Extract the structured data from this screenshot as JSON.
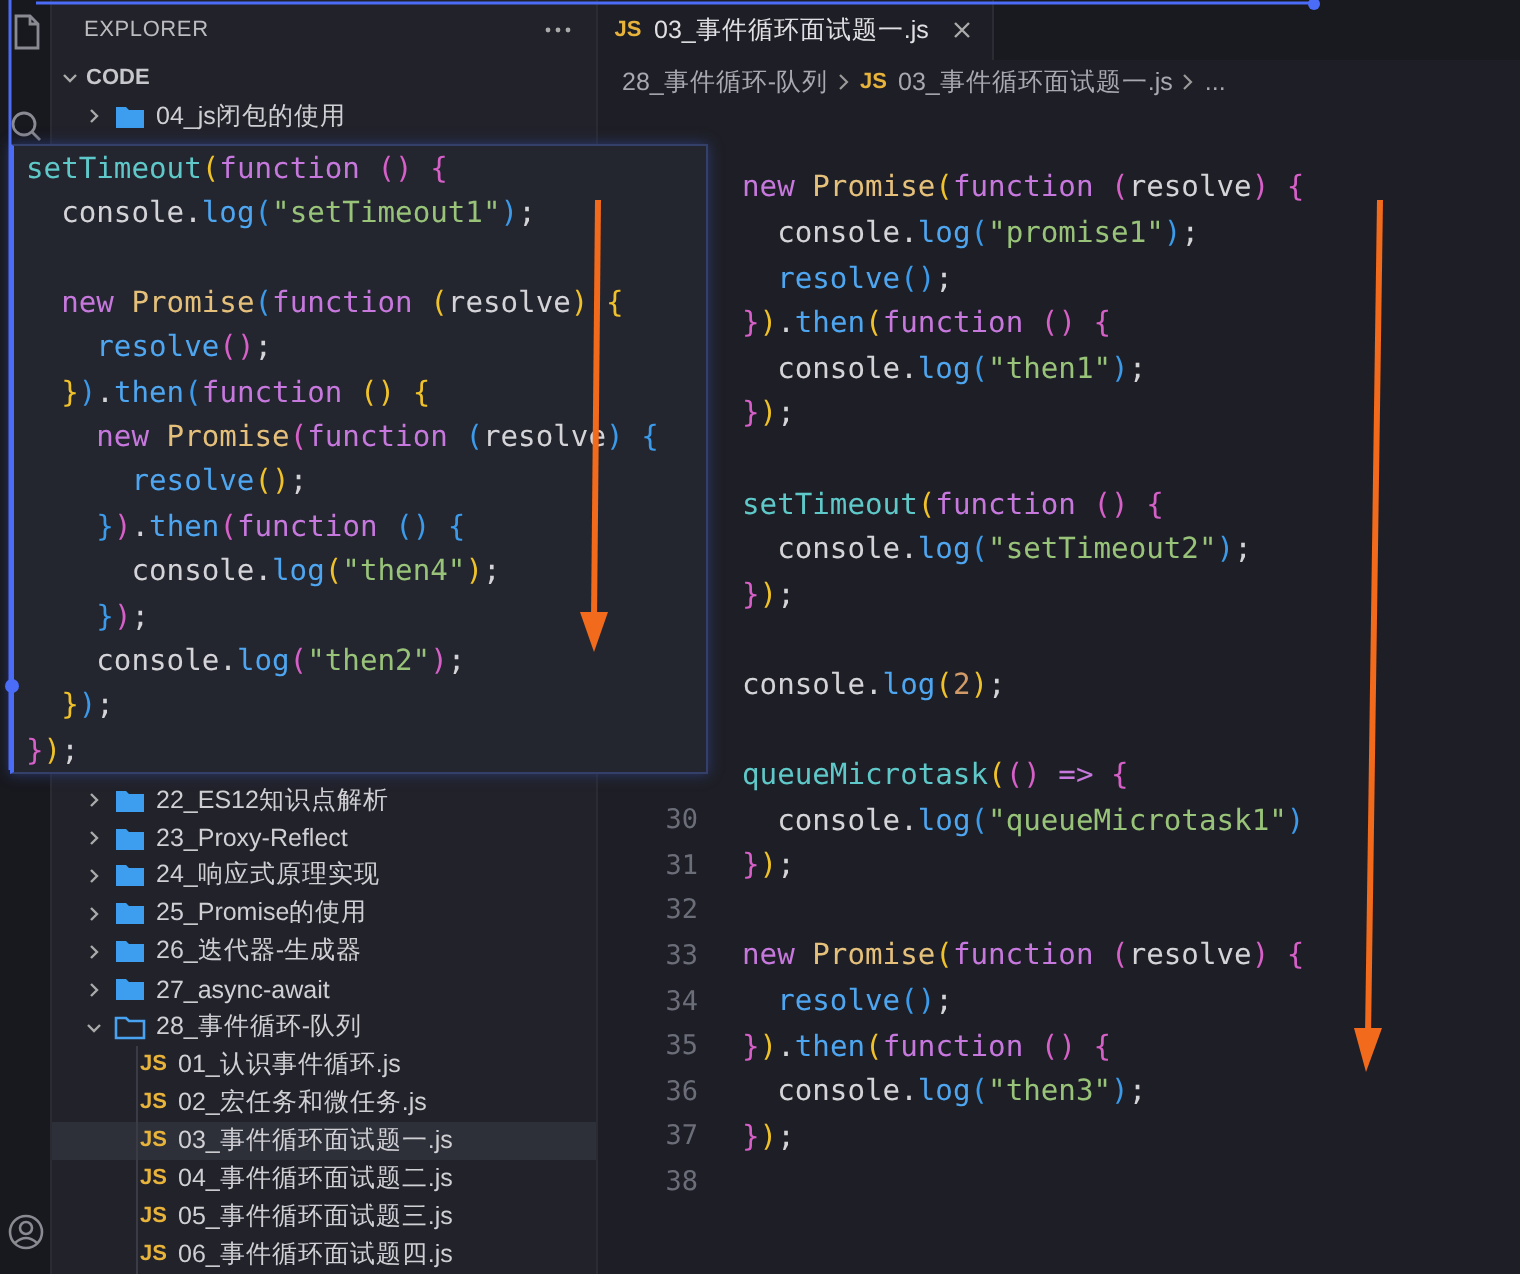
{
  "sidebar": {
    "title": "EXPLORER",
    "section": {
      "label": "CODE",
      "expanded": true
    },
    "items": [
      {
        "label": "04_js闭包的使用",
        "kind": "folder",
        "expanded": false
      },
      {
        "label": "22_ES12知识点解析",
        "kind": "folder",
        "expanded": false
      },
      {
        "label": "23_Proxy-Reflect",
        "kind": "folder",
        "expanded": false
      },
      {
        "label": "24_响应式原理实现",
        "kind": "folder",
        "expanded": false
      },
      {
        "label": "25_Promise的使用",
        "kind": "folder",
        "expanded": false
      },
      {
        "label": "26_迭代器-生成器",
        "kind": "folder",
        "expanded": false
      },
      {
        "label": "27_async-await",
        "kind": "folder",
        "expanded": false
      },
      {
        "label": "28_事件循环-队列",
        "kind": "folder",
        "expanded": true,
        "children": [
          {
            "label": "01_认识事件循环.js",
            "kind": "js",
            "icon": "JS",
            "selected": false
          },
          {
            "label": "02_宏任务和微任务.js",
            "kind": "js",
            "icon": "JS",
            "selected": false
          },
          {
            "label": "03_事件循环面试题一.js",
            "kind": "js",
            "icon": "JS",
            "selected": true
          },
          {
            "label": "04_事件循环面试题二.js",
            "kind": "js",
            "icon": "JS",
            "selected": false
          },
          {
            "label": "05_事件循环面试题三.js",
            "kind": "js",
            "icon": "JS",
            "selected": false
          },
          {
            "label": "06_事件循环面试题四.js",
            "kind": "js",
            "icon": "JS",
            "selected": false
          }
        ]
      }
    ]
  },
  "tabs": [
    {
      "icon": "JS",
      "label": "03_事件循环面试题一.js",
      "selected": true
    }
  ],
  "breadcrumbs": [
    {
      "label": "28_事件循环-队列"
    },
    {
      "icon": "JS",
      "label": "03_事件循环面试题一.js"
    },
    {
      "label": "..."
    }
  ],
  "editor": {
    "lines": [
      {
        "tokens": [
          {
            "kind": "kw",
            "text": "new"
          },
          {
            "kind": "type",
            "text": " Promise"
          },
          {
            "kind": "b1",
            "text": "("
          },
          {
            "kind": "kw",
            "text": "function"
          },
          {
            "kind": "b2",
            "text": " ("
          },
          {
            "kind": "plain",
            "text": "resolve"
          },
          {
            "kind": "b2",
            "text": ")"
          },
          {
            "kind": "b2",
            "text": " {"
          }
        ]
      },
      {
        "tokens": [
          {
            "kind": "plain",
            "text": "  console."
          },
          {
            "kind": "fn",
            "text": "log"
          },
          {
            "kind": "b3",
            "text": "("
          },
          {
            "kind": "str",
            "text": "\"promise1\""
          },
          {
            "kind": "b3",
            "text": ")"
          },
          {
            "kind": "plain",
            "text": ";"
          }
        ]
      },
      {
        "tokens": [
          {
            "kind": "fn",
            "text": "  resolve"
          },
          {
            "kind": "b3",
            "text": "()"
          },
          {
            "kind": "plain",
            "text": ";"
          }
        ]
      },
      {
        "tokens": [
          {
            "kind": "b2",
            "text": "}"
          },
          {
            "kind": "b1",
            "text": ")"
          },
          {
            "kind": "plain",
            "text": "."
          },
          {
            "kind": "fn",
            "text": "then"
          },
          {
            "kind": "b1",
            "text": "("
          },
          {
            "kind": "kw",
            "text": "function"
          },
          {
            "kind": "b2",
            "text": " ()"
          },
          {
            "kind": "b2",
            "text": " {"
          }
        ]
      },
      {
        "tokens": [
          {
            "kind": "plain",
            "text": "  console."
          },
          {
            "kind": "fn",
            "text": "log"
          },
          {
            "kind": "b3",
            "text": "("
          },
          {
            "kind": "str",
            "text": "\"then1\""
          },
          {
            "kind": "b3",
            "text": ")"
          },
          {
            "kind": "plain",
            "text": ";"
          }
        ]
      },
      {
        "tokens": [
          {
            "kind": "b2",
            "text": "}"
          },
          {
            "kind": "b1",
            "text": ")"
          },
          {
            "kind": "plain",
            "text": ";"
          }
        ]
      },
      {
        "gap_before": true,
        "tokens": [
          {
            "kind": "call",
            "text": "setTimeout"
          },
          {
            "kind": "b1",
            "text": "("
          },
          {
            "kind": "kw",
            "text": "function"
          },
          {
            "kind": "b2",
            "text": " ()"
          },
          {
            "kind": "b2",
            "text": " {"
          }
        ]
      },
      {
        "tokens": [
          {
            "kind": "plain",
            "text": "  console."
          },
          {
            "kind": "fn",
            "text": "log"
          },
          {
            "kind": "b3",
            "text": "("
          },
          {
            "kind": "str",
            "text": "\"setTimeout2\""
          },
          {
            "kind": "b3",
            "text": ")"
          },
          {
            "kind": "plain",
            "text": ";"
          }
        ]
      },
      {
        "tokens": [
          {
            "kind": "b2",
            "text": "}"
          },
          {
            "kind": "b1",
            "text": ")"
          },
          {
            "kind": "plain",
            "text": ";"
          }
        ]
      },
      {
        "gap_before": true,
        "tokens": [
          {
            "kind": "plain",
            "text": "console."
          },
          {
            "kind": "fn",
            "text": "log"
          },
          {
            "kind": "b1",
            "text": "("
          },
          {
            "kind": "num",
            "text": "2"
          },
          {
            "kind": "b1",
            "text": ")"
          },
          {
            "kind": "plain",
            "text": ";"
          }
        ]
      },
      {
        "gap_before": true,
        "tokens": [
          {
            "kind": "call",
            "text": "queueMicrotask"
          },
          {
            "kind": "b1",
            "text": "("
          },
          {
            "kind": "b2",
            "text": "()"
          },
          {
            "kind": "kw",
            "text": " =>"
          },
          {
            "kind": "b2",
            "text": " {"
          }
        ]
      },
      {
        "number": "30",
        "tokens": [
          {
            "kind": "plain",
            "text": "  console."
          },
          {
            "kind": "fn",
            "text": "log"
          },
          {
            "kind": "b3",
            "text": "("
          },
          {
            "kind": "str",
            "text": "\"queueMicrotask1\""
          },
          {
            "kind": "b3",
            "text": ")"
          }
        ]
      },
      {
        "number": "31",
        "tokens": [
          {
            "kind": "b2",
            "text": "}"
          },
          {
            "kind": "b1",
            "text": ")"
          },
          {
            "kind": "plain",
            "text": ";"
          }
        ]
      },
      {
        "number": "32"
      },
      {
        "number": "33",
        "tokens": [
          {
            "kind": "kw",
            "text": "new"
          },
          {
            "kind": "type",
            "text": " Promise"
          },
          {
            "kind": "b1",
            "text": "("
          },
          {
            "kind": "kw",
            "text": "function"
          },
          {
            "kind": "b2",
            "text": " ("
          },
          {
            "kind": "plain",
            "text": "resolve"
          },
          {
            "kind": "b2",
            "text": ")"
          },
          {
            "kind": "b2",
            "text": " {"
          }
        ]
      },
      {
        "number": "34",
        "tokens": [
          {
            "kind": "fn",
            "text": "  resolve"
          },
          {
            "kind": "b3",
            "text": "()"
          },
          {
            "kind": "plain",
            "text": ";"
          }
        ]
      },
      {
        "number": "35",
        "tokens": [
          {
            "kind": "b2",
            "text": "}"
          },
          {
            "kind": "b1",
            "text": ")"
          },
          {
            "kind": "plain",
            "text": "."
          },
          {
            "kind": "fn",
            "text": "then"
          },
          {
            "kind": "b1",
            "text": "("
          },
          {
            "kind": "kw",
            "text": "function"
          },
          {
            "kind": "b2",
            "text": " ()"
          },
          {
            "kind": "b2",
            "text": " {"
          }
        ]
      },
      {
        "number": "36",
        "tokens": [
          {
            "kind": "plain",
            "text": "  console."
          },
          {
            "kind": "fn",
            "text": "log"
          },
          {
            "kind": "b3",
            "text": "("
          },
          {
            "kind": "str",
            "text": "\"then3\""
          },
          {
            "kind": "b3",
            "text": ")"
          },
          {
            "kind": "plain",
            "text": ";"
          }
        ]
      },
      {
        "number": "37",
        "tokens": [
          {
            "kind": "b2",
            "text": "}"
          },
          {
            "kind": "b1",
            "text": ")"
          },
          {
            "kind": "plain",
            "text": ";"
          }
        ]
      },
      {
        "number": "38"
      }
    ]
  },
  "overlay": {
    "lines": [
      {
        "tokens": [
          {
            "kind": "call",
            "text": "setTimeout"
          },
          {
            "kind": "b1",
            "text": "("
          },
          {
            "kind": "kw",
            "text": "function"
          },
          {
            "kind": "b2",
            "text": " ()"
          },
          {
            "kind": "b2",
            "text": " {"
          }
        ]
      },
      {
        "tokens": [
          {
            "kind": "plain",
            "text": "  console."
          },
          {
            "kind": "fn",
            "text": "log"
          },
          {
            "kind": "b3",
            "text": "("
          },
          {
            "kind": "str",
            "text": "\"setTimeout1\""
          },
          {
            "kind": "b3",
            "text": ")"
          },
          {
            "kind": "plain",
            "text": ";"
          }
        ]
      },
      {
        "gap_before": true,
        "tokens": [
          {
            "kind": "kw",
            "text": "  new"
          },
          {
            "kind": "type",
            "text": " Promise"
          },
          {
            "kind": "b3",
            "text": "("
          },
          {
            "kind": "kw",
            "text": "function"
          },
          {
            "kind": "b1",
            "text": " ("
          },
          {
            "kind": "plain",
            "text": "resolve"
          },
          {
            "kind": "b1",
            "text": ")"
          },
          {
            "kind": "b1",
            "text": " {"
          }
        ]
      },
      {
        "tokens": [
          {
            "kind": "fn",
            "text": "    resolve"
          },
          {
            "kind": "b2",
            "text": "()"
          },
          {
            "kind": "plain",
            "text": ";"
          }
        ]
      },
      {
        "tokens": [
          {
            "kind": "b1",
            "text": "  }"
          },
          {
            "kind": "b3",
            "text": ")"
          },
          {
            "kind": "plain",
            "text": "."
          },
          {
            "kind": "fn",
            "text": "then"
          },
          {
            "kind": "b3",
            "text": "("
          },
          {
            "kind": "kw",
            "text": "function"
          },
          {
            "kind": "b1",
            "text": " ()"
          },
          {
            "kind": "b1",
            "text": " {"
          }
        ]
      },
      {
        "tokens": [
          {
            "kind": "kw",
            "text": "    new"
          },
          {
            "kind": "type",
            "text": " Promise"
          },
          {
            "kind": "b2",
            "text": "("
          },
          {
            "kind": "kw",
            "text": "function"
          },
          {
            "kind": "b3",
            "text": " ("
          },
          {
            "kind": "plain",
            "text": "resolve"
          },
          {
            "kind": "b3",
            "text": ")"
          },
          {
            "kind": "b3",
            "text": " {"
          }
        ]
      },
      {
        "tokens": [
          {
            "kind": "fn",
            "text": "      resolve"
          },
          {
            "kind": "b1",
            "text": "()"
          },
          {
            "kind": "plain",
            "text": ";"
          }
        ]
      },
      {
        "tokens": [
          {
            "kind": "b3",
            "text": "    }"
          },
          {
            "kind": "b2",
            "text": ")"
          },
          {
            "kind": "plain",
            "text": "."
          },
          {
            "kind": "fn",
            "text": "then"
          },
          {
            "kind": "b2",
            "text": "("
          },
          {
            "kind": "kw",
            "text": "function"
          },
          {
            "kind": "b3",
            "text": " ()"
          },
          {
            "kind": "b3",
            "text": " {"
          }
        ]
      },
      {
        "tokens": [
          {
            "kind": "plain",
            "text": "      console."
          },
          {
            "kind": "fn",
            "text": "log"
          },
          {
            "kind": "b1",
            "text": "("
          },
          {
            "kind": "str",
            "text": "\"then4\""
          },
          {
            "kind": "b1",
            "text": ")"
          },
          {
            "kind": "plain",
            "text": ";"
          }
        ]
      },
      {
        "tokens": [
          {
            "kind": "b3",
            "text": "    }"
          },
          {
            "kind": "b2",
            "text": ")"
          },
          {
            "kind": "plain",
            "text": ";"
          }
        ]
      },
      {
        "tokens": [
          {
            "kind": "plain",
            "text": "    console."
          },
          {
            "kind": "fn",
            "text": "log"
          },
          {
            "kind": "b2",
            "text": "("
          },
          {
            "kind": "str",
            "text": "\"then2\""
          },
          {
            "kind": "b2",
            "text": ")"
          },
          {
            "kind": "plain",
            "text": ";"
          }
        ]
      },
      {
        "tokens": [
          {
            "kind": "b1",
            "text": "  }"
          },
          {
            "kind": "b3",
            "text": ")"
          },
          {
            "kind": "plain",
            "text": ";"
          }
        ]
      },
      {
        "tokens": [
          {
            "kind": "b2",
            "text": "}"
          },
          {
            "kind": "b1",
            "text": ")"
          },
          {
            "kind": "plain",
            "text": ";"
          }
        ]
      }
    ]
  }
}
